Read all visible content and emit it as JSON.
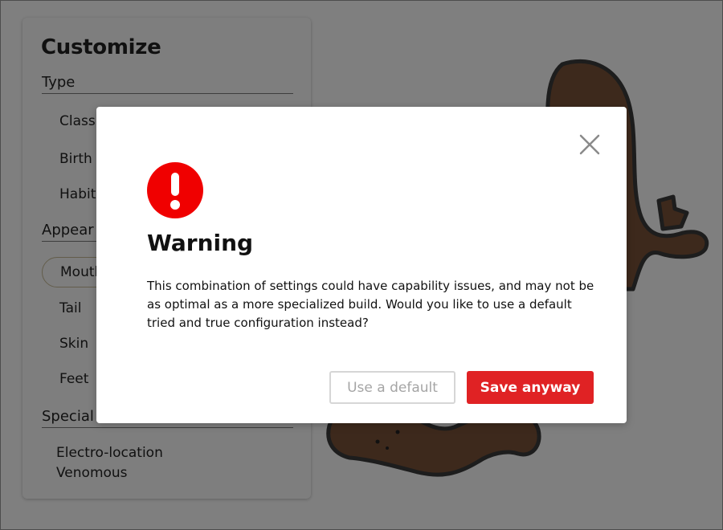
{
  "panel": {
    "title": "Customize",
    "sections": {
      "type": "Type",
      "appearance": "Appear",
      "special": "Special"
    },
    "type_items": [
      "Class",
      "Birth",
      "Habit"
    ],
    "appearance_items": [
      "Mouth",
      "Tail",
      "Skin",
      "Feet"
    ],
    "special_items": [
      "Electro-location",
      "Venomous"
    ]
  },
  "modal": {
    "title": "Warning",
    "body": "This combination of settings could have capability issues, and may not be as optimal as a more specialized build. Would you like to use a default tried and true configuration instead?",
    "default_button": "Use a default",
    "save_button": "Save anyway",
    "icon": "exclamation-circle-icon",
    "close_icon": "close-icon"
  },
  "colors": {
    "accent_red": "#e02224",
    "overlay": "rgba(0,0,0,0.5)",
    "platypus_brown": "#7a5238"
  }
}
